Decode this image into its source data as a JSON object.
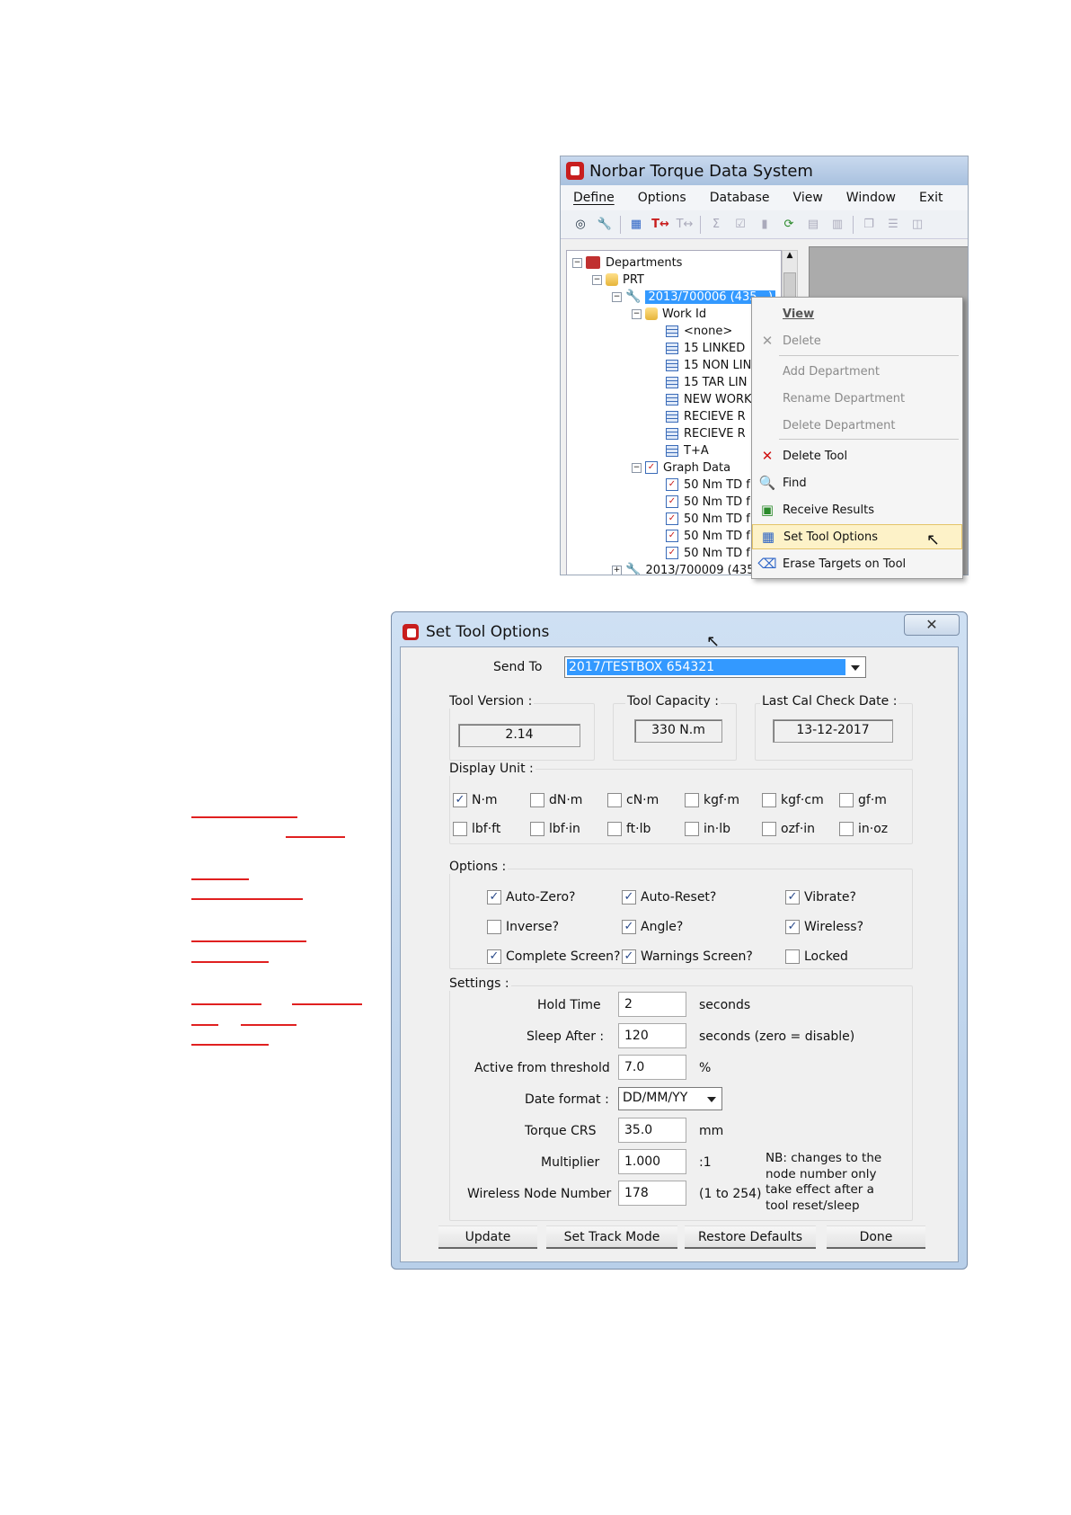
{
  "app": {
    "title": "Norbar Torque Data System",
    "menu": [
      "Define",
      "Options",
      "Database",
      "View",
      "Window",
      "Exit"
    ]
  },
  "tree": {
    "root": "Departments",
    "dept": "PRT",
    "tool_selected": "2013/700006 (435...)",
    "workid": "Work Id",
    "workid_items": [
      "<none>",
      "15 LINKED",
      "15 NON LIN",
      "15 TAR LIN",
      "NEW WORK",
      "RECIEVE R",
      "RECIEVE R",
      "T+A"
    ],
    "graph": "Graph Data",
    "graph_items": [
      "50 Nm TD f",
      "50 Nm TD f",
      "50 Nm TD f",
      "50 Nm TD f",
      "50 Nm TD f"
    ],
    "tool2": "2013/700009 (435..."
  },
  "context_menu": {
    "items": [
      {
        "label": "View",
        "icon": "none",
        "disabled": false,
        "bold": true
      },
      {
        "label": "Delete",
        "icon": "x-gray-icon",
        "disabled": true
      },
      {
        "label": "Add Department",
        "icon": "none",
        "disabled": true
      },
      {
        "label": "Rename Department",
        "icon": "none",
        "disabled": true
      },
      {
        "label": "Delete Department",
        "icon": "none",
        "disabled": true
      },
      {
        "label": "Delete Tool",
        "icon": "x-red-icon",
        "disabled": false
      },
      {
        "label": "Find",
        "icon": "magnifier-icon",
        "disabled": false
      },
      {
        "label": "Receive Results",
        "icon": "receive-icon",
        "disabled": false
      },
      {
        "label": "Set Tool Options",
        "icon": "tool-options-icon",
        "disabled": false,
        "highlighted": true
      },
      {
        "label": "Erase Targets on Tool",
        "icon": "eraser-icon",
        "disabled": false
      }
    ]
  },
  "dialog": {
    "title": "Set Tool Options",
    "close": "✕",
    "send_to_label": "Send To",
    "send_to_value": "2017/TESTBOX   654321",
    "tool_version_label": "Tool Version :",
    "tool_version": "2.14",
    "tool_capacity_label": "Tool Capacity :",
    "tool_capacity": "330 N.m",
    "last_cal_label": "Last Cal Check Date :",
    "last_cal": "13-12-2017",
    "display_unit_label": "Display Unit :",
    "units": [
      {
        "label": "N·m",
        "checked": true
      },
      {
        "label": "dN·m",
        "checked": false
      },
      {
        "label": "cN·m",
        "checked": false
      },
      {
        "label": "kgf·m",
        "checked": false
      },
      {
        "label": "kgf·cm",
        "checked": false
      },
      {
        "label": "gf·m",
        "checked": false
      },
      {
        "label": "lbf·ft",
        "checked": false
      },
      {
        "label": "lbf·in",
        "checked": false
      },
      {
        "label": "ft·lb",
        "checked": false
      },
      {
        "label": "in·lb",
        "checked": false
      },
      {
        "label": "ozf·in",
        "checked": false
      },
      {
        "label": "in·oz",
        "checked": false
      }
    ],
    "options_label": "Options :",
    "options": [
      {
        "label": "Auto-Zero?",
        "checked": true
      },
      {
        "label": "Auto-Reset?",
        "checked": true
      },
      {
        "label": "Vibrate?",
        "checked": true
      },
      {
        "label": "Inverse?",
        "checked": false
      },
      {
        "label": "Angle?",
        "checked": true
      },
      {
        "label": "Wireless?",
        "checked": true
      },
      {
        "label": "Complete Screen?",
        "checked": true
      },
      {
        "label": "Warnings Screen?",
        "checked": true
      },
      {
        "label": "Locked",
        "checked": false
      }
    ],
    "settings_label": "Settings :",
    "settings": [
      {
        "label": "Hold Time",
        "value": "2",
        "unit": "seconds"
      },
      {
        "label": "Sleep After :",
        "value": "120",
        "unit": "seconds (zero = disable)"
      },
      {
        "label": "Active from threshold",
        "value": "7.0",
        "unit": "%"
      },
      {
        "label": "Date format :",
        "value": "DD/MM/YY",
        "unit": ""
      },
      {
        "label": "Torque CRS",
        "value": "35.0",
        "unit": "mm"
      },
      {
        "label": "Multiplier",
        "value": "1.000",
        "unit": ":1"
      },
      {
        "label": "Wireless Node Number",
        "value": "178",
        "unit": "(1 to 254)"
      }
    ],
    "note": "NB: changes to the node number only take effect after a tool reset/sleep",
    "buttons": [
      "Update",
      "Set Track Mode",
      "Restore Defaults",
      "Done"
    ]
  }
}
